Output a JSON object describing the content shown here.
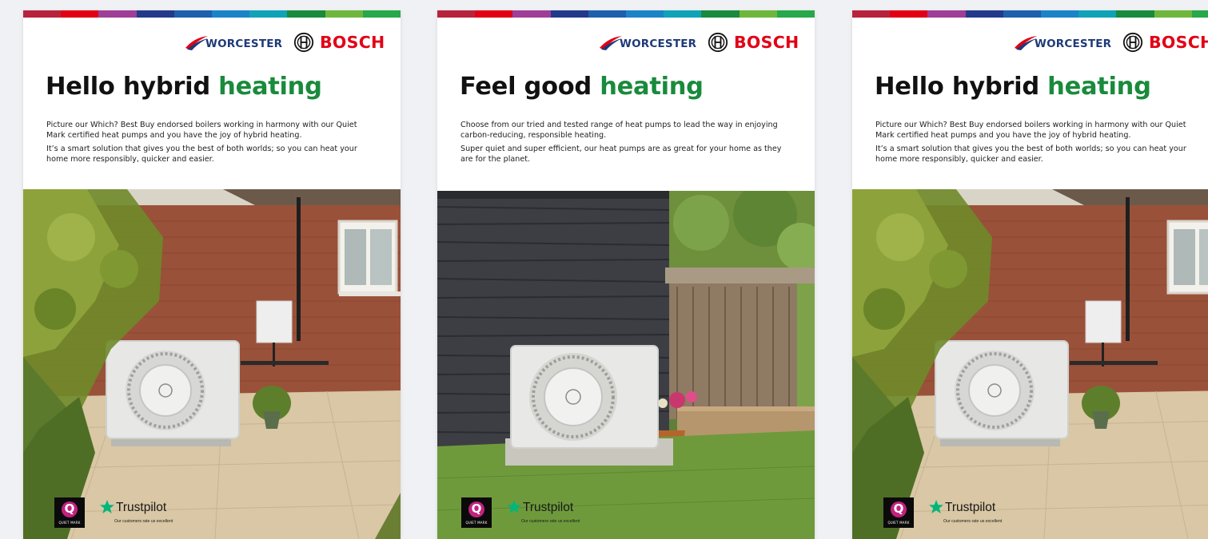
{
  "brand": {
    "stripe_colors": [
      "#b7233d",
      "#e20015",
      "#9f3e97",
      "#233a8b",
      "#1f5fad",
      "#1b83c7",
      "#0fa3b8",
      "#1a8a3c",
      "#6fb73c",
      "#27a84a"
    ],
    "worcester_text": "WORCESTER",
    "bosch_text": "BOSCH",
    "colors": {
      "worcester_blue": "#1e3a78",
      "bosch_red": "#e20015",
      "heading_green": "#1a8a3c"
    }
  },
  "leaflets": [
    {
      "headline_main": "Hello hybrid ",
      "headline_accent": "heating",
      "paragraph_1": "Picture our Which? Best Buy endorsed boilers working in harmony with our Quiet Mark certified heat pumps and you have the joy of hybrid heating.",
      "paragraph_2": "It’s a smart solution that gives you the best of both worlds; so you can heat your home more responsibly, quicker and easier.",
      "image_scene": "brick-patio-heat-pump",
      "quietmark_label": "QUIET MARK",
      "trustpilot_name": "Trustpilot",
      "trustpilot_rating": "Our customers rate us excellent"
    },
    {
      "headline_main": "Feel good ",
      "headline_accent": "heating",
      "paragraph_1": "Choose from our tried and tested range of heat pumps to lead the way in enjoying carbon-reducing, responsible heating.",
      "paragraph_2": "Super quiet and super efficient, our heat pumps are as great for your home as they are for the planet.",
      "image_scene": "slate-wall-garden-heat-pump",
      "quietmark_label": "QUIET MARK",
      "trustpilot_name": "Trustpilot",
      "trustpilot_rating": "Our customers rate us excellent"
    },
    {
      "headline_main": "Hello hybrid ",
      "headline_accent": "heating",
      "paragraph_1": "Picture our Which? Best Buy endorsed boilers working in harmony with our Quiet Mark certified heat pumps and you have the joy of hybrid heating.",
      "paragraph_2": "It’s a smart solution that gives you the best of both worlds; so you can heat your home more responsibly, quicker and easier.",
      "image_scene": "brick-patio-heat-pump",
      "quietmark_label": "QUIET MARK",
      "trustpilot_name": "Trustpilot",
      "trustpilot_rating": "Our customers rate us excellent"
    }
  ]
}
